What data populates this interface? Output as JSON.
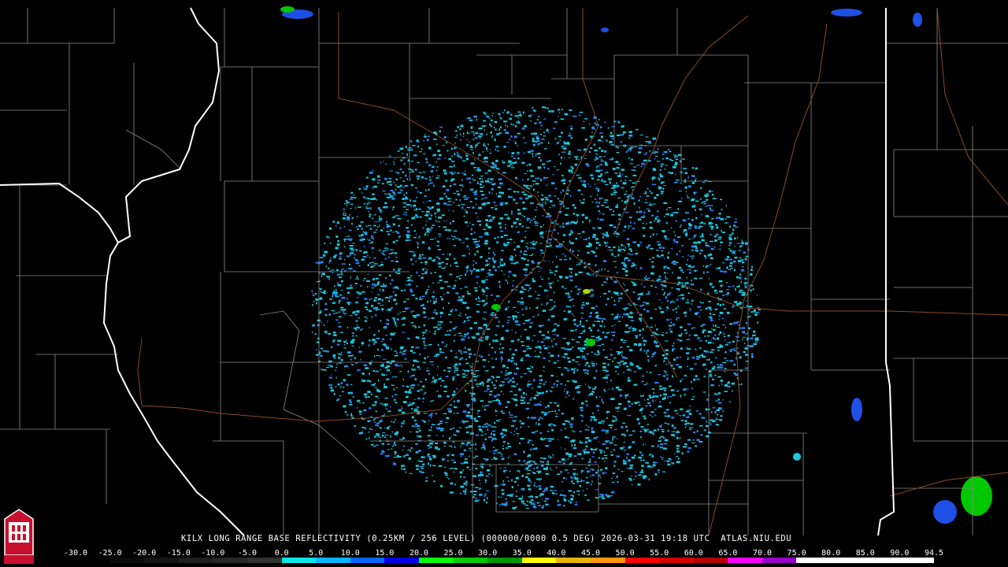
{
  "product_caption": "KILX LONG RANGE BASE REFLECTIVITY (0.25KM / 256 LEVEL) (000000/0000 0.5 DEG) 2026-03-31 19:18 UTC  ATLAS.NIU.EDU",
  "scale_labels": [
    "-30.0",
    "-25.0",
    "-20.0",
    "-15.0",
    "-10.0",
    "-5.0",
    "0.0",
    "5.0",
    "10.0",
    "15.0",
    "20.0",
    "25.0",
    "30.0",
    "35.0",
    "40.0",
    "45.0",
    "50.0",
    "55.0",
    "60.0",
    "65.0",
    "70.0",
    "75.0",
    "80.0",
    "85.0",
    "90.0",
    "94.5"
  ],
  "scale_colors": [
    "#000000",
    "#0a0a0a",
    "#141414",
    "#1e1e1e",
    "#282828",
    "#323232",
    "#00e6e6",
    "#00b4ff",
    "#0064ff",
    "#0000e6",
    "#00ff00",
    "#00c800",
    "#009600",
    "#ffff00",
    "#e6b400",
    "#ff9600",
    "#ff0000",
    "#d20000",
    "#b40000",
    "#ff00ff",
    "#9600c8",
    "#ffffff",
    "#ffffff",
    "#ffffff",
    "#ffffff"
  ],
  "logo_text": "NIU",
  "colors": {
    "state_border": "#ffffff",
    "county_border": "#8c8c8c",
    "highway": "#8a4a2a",
    "echo": "#19c8dc"
  }
}
